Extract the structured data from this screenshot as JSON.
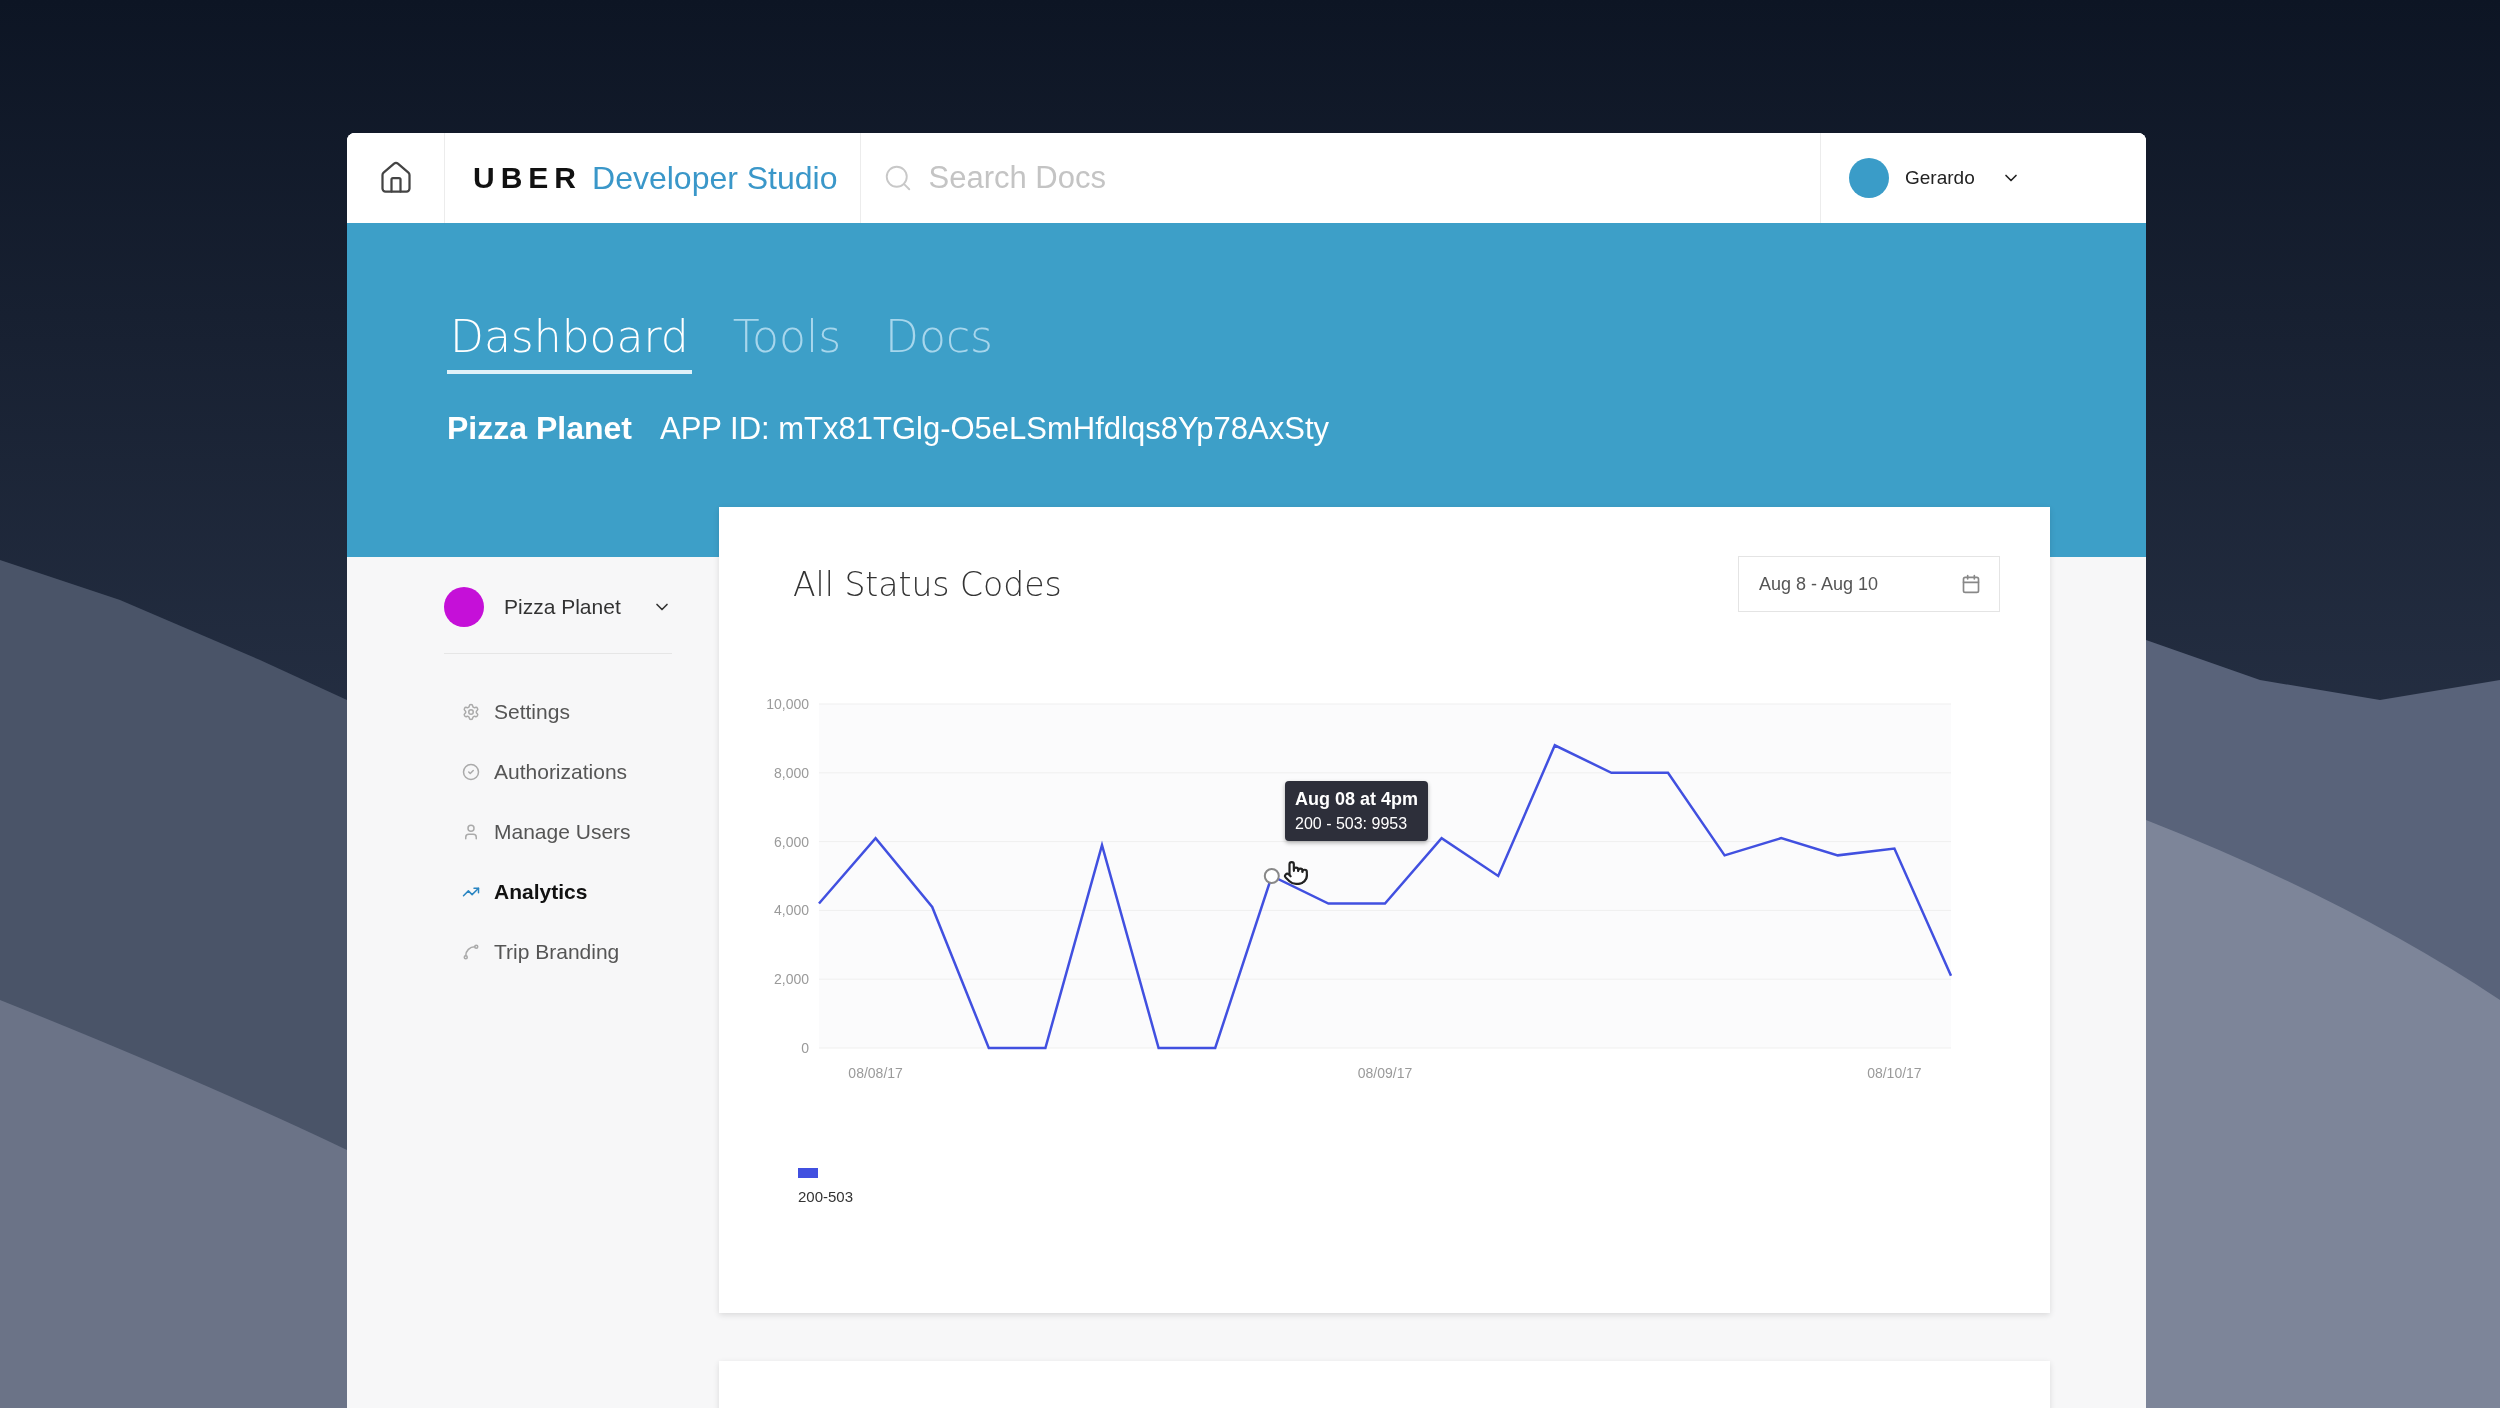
{
  "header": {
    "brand": "UBER",
    "product": "Developer Studio",
    "search": {
      "placeholder": "Search Docs"
    },
    "user": {
      "name": "Gerardo"
    }
  },
  "tabs": [
    {
      "label": "Dashboard",
      "selected": true
    },
    {
      "label": "Tools",
      "selected": false
    },
    {
      "label": "Docs",
      "selected": false
    }
  ],
  "app": {
    "name": "Pizza Planet",
    "app_id": "APP ID: mTx81TGlg-O5eLSmHfdlqs8Yp78AxSty"
  },
  "sidebar": {
    "app_selector": {
      "name": "Pizza Planet",
      "color": "#c510d8"
    },
    "items": [
      {
        "label": "Settings",
        "kind": "settings",
        "selected": false
      },
      {
        "label": "Authorizations",
        "kind": "authorizations",
        "selected": false
      },
      {
        "label": "Manage Users",
        "kind": "users",
        "selected": false
      },
      {
        "label": "Analytics",
        "kind": "analytics",
        "selected": true
      },
      {
        "label": "Trip Branding",
        "kind": "branding",
        "selected": false
      }
    ]
  },
  "chart_card": {
    "title": "All Status Codes",
    "date_range": "Aug 8 - Aug 10",
    "tooltip": {
      "title": "Aug 08 at 4pm",
      "text": "200 - 503: 9953"
    },
    "chart_data": {
      "type": "line",
      "categories": [
        null,
        "08/08/17",
        null,
        null,
        null,
        null,
        null,
        null,
        null,
        null,
        "08/09/17",
        null,
        null,
        null,
        null,
        null,
        null,
        null,
        null,
        "08/10/17",
        null
      ],
      "series": [
        {
          "name": "200-503",
          "color": "#4150e0",
          "values": [
            4200,
            6100,
            4100,
            0,
            0,
            5900,
            0,
            0,
            5000,
            4200,
            4200,
            6100,
            5000,
            8800,
            8000,
            8000,
            5600,
            6100,
            5600,
            5800,
            2100
          ]
        }
      ],
      "ylim": [
        0,
        10000
      ],
      "grid": true,
      "yticks": [
        {
          "value": 0,
          "label": "0"
        },
        {
          "value": 2000,
          "label": "2,000"
        },
        {
          "value": 4000,
          "label": "4,000"
        },
        {
          "value": 6000,
          "label": "6,000"
        },
        {
          "value": 8000,
          "label": "8,000"
        },
        {
          "value": 10000,
          "label": "10,000"
        }
      ]
    }
  }
}
